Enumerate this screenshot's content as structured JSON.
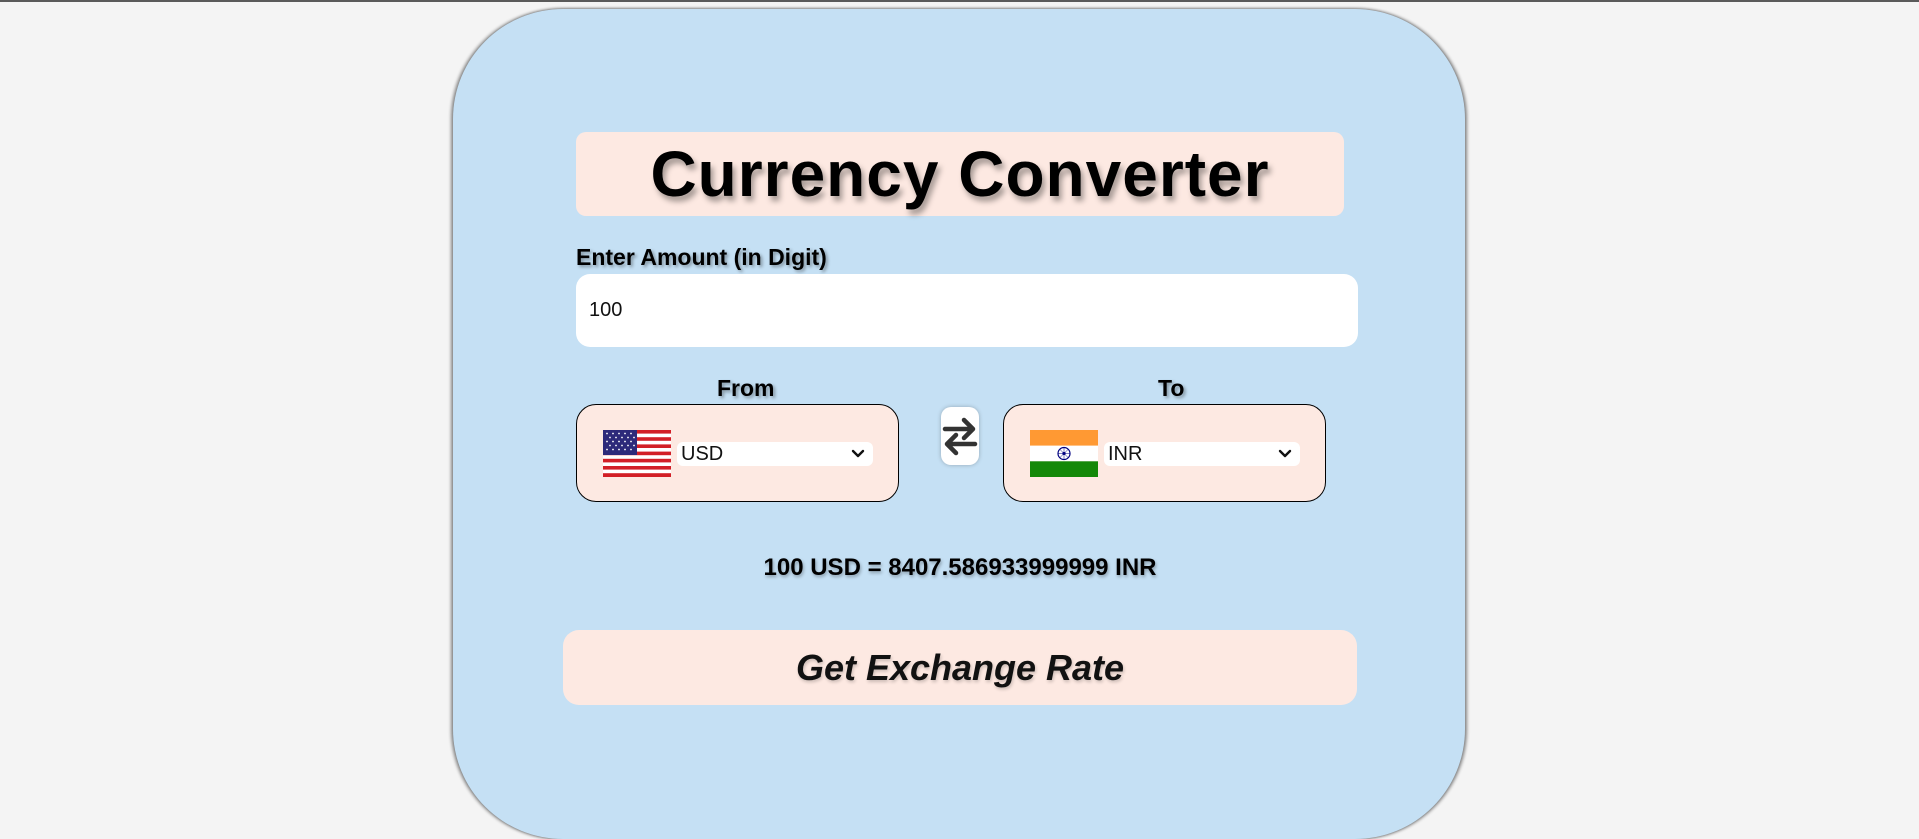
{
  "header": {
    "title": "Currency Converter"
  },
  "amount": {
    "label": "Enter Amount (in Digit)",
    "value": "100"
  },
  "from": {
    "label": "From",
    "currency": "USD",
    "flag": "us-flag-icon"
  },
  "to": {
    "label": "To",
    "currency": "INR",
    "flag": "in-flag-icon"
  },
  "swap": {
    "icon": "swap-arrows-icon"
  },
  "result": {
    "text": "100 USD = 8407.586933999999 INR"
  },
  "action": {
    "label": "Get Exchange Rate"
  },
  "colors": {
    "page_background": "#f4f4f4",
    "card_background": "#c5e0f4",
    "panel_background": "#fde9e2"
  }
}
